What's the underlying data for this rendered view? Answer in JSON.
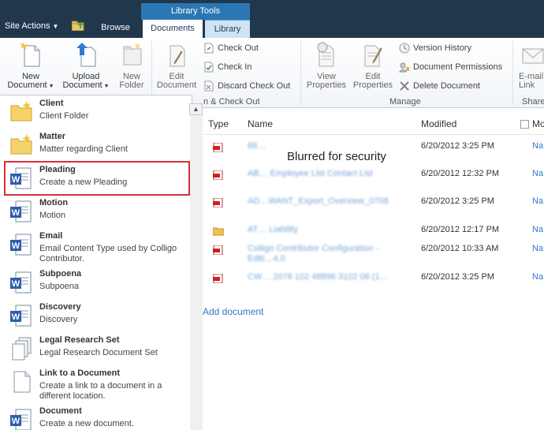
{
  "topbar": {
    "site_actions": "Site Actions",
    "tab_browse": "Browse",
    "contextual_group": "Library Tools",
    "tab_documents": "Documents",
    "tab_library": "Library"
  },
  "ribbon": {
    "new_document": "New Document",
    "upload_document": "Upload Document",
    "new_folder": "New Folder",
    "edit_document": "Edit Document",
    "check_out": "Check Out",
    "check_in": "Check In",
    "discard_check_out": "Discard Check Out",
    "group_open_check_out": "n & Check Out",
    "view_properties": "View Properties",
    "edit_properties": "Edit Properties",
    "version_history": "Version History",
    "document_permissions": "Document Permissions",
    "delete_document": "Delete Document",
    "group_manage": "Manage",
    "email_link": "E-mail Link",
    "group_share": "Share"
  },
  "list": {
    "headers": {
      "type": "Type",
      "name": "Name",
      "modified": "Modified",
      "mo": "Mo"
    },
    "blur_note": "Blurred for security",
    "rows": [
      {
        "type": "pdf",
        "name": "88…",
        "modified": "6/20/2012 3:25 PM",
        "mo": "Na"
      },
      {
        "type": "word",
        "name": "AB… Employee List Contact List",
        "modified": "6/20/2012 12:32 PM",
        "mo": "Na"
      },
      {
        "type": "pdf",
        "name": "AD…WANT_Export_Overview_0708",
        "modified": "6/20/2012 3:25 PM",
        "mo": "Na"
      },
      {
        "type": "folder",
        "name": "AT… Liability",
        "modified": "6/20/2012 12:17 PM",
        "mo": "Na"
      },
      {
        "type": "pdf",
        "name": "Colligo Contributor Configuration -Editi…4.0",
        "modified": "6/20/2012 10:33 AM",
        "mo": "Na"
      },
      {
        "type": "pdf",
        "name": "CW… 2076 102 48896 3102 08 (1…",
        "modified": "6/20/2012 3:25 PM",
        "mo": "Na"
      }
    ],
    "add_document": "Add document"
  },
  "menu": {
    "items": [
      {
        "icon": "folder-new-icon",
        "title": "Client",
        "desc": "Client Folder"
      },
      {
        "icon": "folder-new-icon",
        "title": "Matter",
        "desc": "Matter regarding Client"
      },
      {
        "icon": "word-doc-icon",
        "title": "Pleading",
        "desc": "Create a new Pleading"
      },
      {
        "icon": "word-doc-icon",
        "title": "Motion",
        "desc": "Motion"
      },
      {
        "icon": "word-doc-icon",
        "title": "Email",
        "desc": "Email Content Type used by Colligo Contributor."
      },
      {
        "icon": "word-doc-icon",
        "title": "Subpoena",
        "desc": "Subpoena"
      },
      {
        "icon": "word-doc-icon",
        "title": "Discovery",
        "desc": "Discovery"
      },
      {
        "icon": "document-set-icon",
        "title": "Legal Research Set",
        "desc": "Legal Research Document Set"
      },
      {
        "icon": "link-document-icon",
        "title": "Link to a Document",
        "desc": "Create a link to a document in a different location."
      },
      {
        "icon": "word-doc-icon",
        "title": "Document",
        "desc": "Create a new document."
      }
    ]
  },
  "colors": {
    "nav_bg": "#21374c",
    "contextual_tab": "#2a77b3",
    "highlight_red": "#d53139",
    "link_blue": "#3377c7"
  }
}
